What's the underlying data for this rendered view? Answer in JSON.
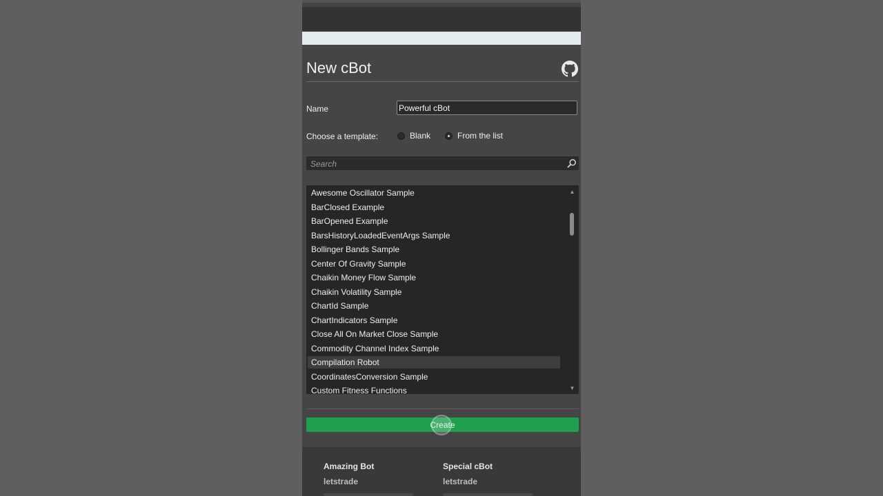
{
  "dialog": {
    "title": "New cBot",
    "name_label": "Name",
    "name_value": "Powerful cBot",
    "template_label": "Choose a template:",
    "template_options": [
      "Blank",
      "From the list"
    ],
    "template_selected": "From the list",
    "search_placeholder": "Search",
    "create_label": "Create"
  },
  "templates": [
    "Awesome Oscillator Sample",
    "BarClosed Example",
    "BarOpened Example",
    "BarsHistoryLoadedEventArgs Sample",
    "Bollinger Bands Sample",
    "Center Of Gravity Sample",
    "Chaikin Money Flow Sample",
    "Chaikin Volatility Sample",
    "ChartId Sample",
    "ChartIndicators Sample",
    "Close All On Market Close Sample",
    "Commodity Channel Index Sample",
    "Compilation Robot",
    "CoordinatesConversion Sample",
    "Custom Fitness Functions"
  ],
  "selected_template": "Compilation Robot",
  "cards": [
    {
      "title": "Amazing Bot",
      "author": "letstrade"
    },
    {
      "title": "Special cBot",
      "author": "letstrade"
    }
  ],
  "icons": {
    "github": "github-icon",
    "search": "search-icon"
  },
  "colors": {
    "accent": "#1fa04f",
    "panel": "#454545",
    "list_bg": "#262626"
  }
}
